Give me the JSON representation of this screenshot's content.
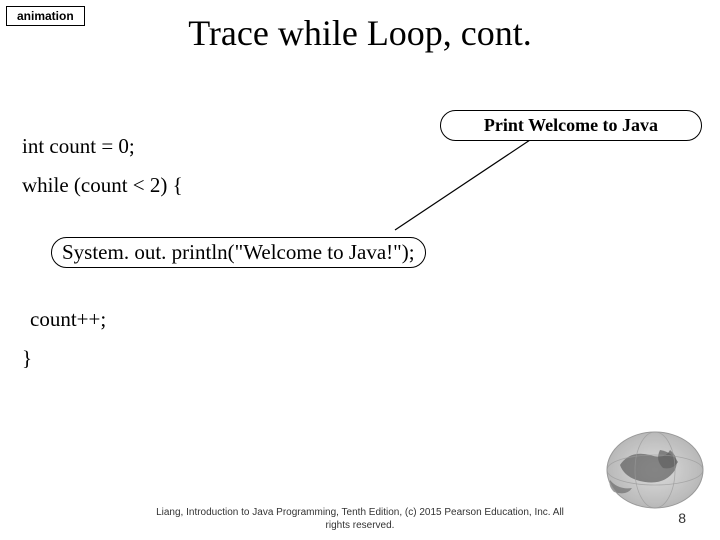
{
  "badge": "animation",
  "title": "Trace while Loop, cont.",
  "callout": "Print Welcome to Java",
  "code": {
    "line1": "int count = 0;",
    "line2": "while (count < 2) {",
    "line3": "System. out. println(\"Welcome to Java!\");",
    "line4": "count++;",
    "line5": "}"
  },
  "footer": {
    "line1": "Liang, Introduction to Java Programming, Tenth Edition, (c) 2015 Pearson Education, Inc. All",
    "line2": "rights reserved."
  },
  "page_number": "8"
}
